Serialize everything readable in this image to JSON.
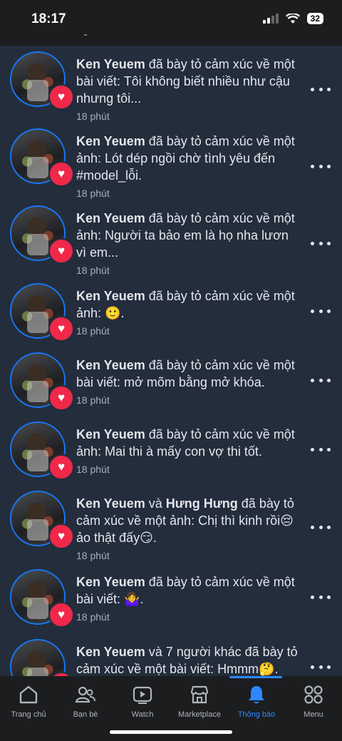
{
  "status": {
    "time": "18:17",
    "battery": "32"
  },
  "notifications": [
    {
      "actor": "Ken Yeuem",
      "actor2": "",
      "pre": "",
      "mid": "",
      "action": " đã bày tỏ cảm xúc về một bài viết: Tôi không biết nhiều như cậu nhưng tôi...",
      "time": "18 phút"
    },
    {
      "actor": "Ken Yeuem",
      "actor2": "",
      "pre": "",
      "mid": "",
      "action": " đã bày tỏ cảm xúc về một ảnh: Lót dép ngồi chờ tình yêu đến #model_lỗi.",
      "time": "18 phút"
    },
    {
      "actor": "Ken Yeuem",
      "actor2": "",
      "pre": "",
      "mid": "",
      "action": " đã bày tỏ cảm xúc về một ảnh: Người ta bảo em là họ nha lươn vì em...",
      "time": "18 phút"
    },
    {
      "actor": "Ken Yeuem",
      "actor2": "",
      "pre": "",
      "mid": "",
      "action": " đã bày tỏ cảm xúc về một ảnh: 🙂.",
      "time": "18 phút"
    },
    {
      "actor": "Ken Yeuem",
      "actor2": "",
      "pre": "",
      "mid": "",
      "action": " đã bày tỏ cảm xúc về một bài viết: mở mõm bằng mở khóa.",
      "time": "18 phút"
    },
    {
      "actor": "Ken Yeuem",
      "actor2": "",
      "pre": "",
      "mid": "",
      "action": " đã bày tỏ cảm xúc về một ảnh: Mai thi à mấy con vợ thi tốt.",
      "time": "18 phút"
    },
    {
      "actor": "Ken Yeuem",
      "actor2": "Hưng Hưng",
      "pre": "",
      "mid": " và ",
      "action": " đã bày tỏ cảm xúc về một ảnh: Chị thì kinh rồi😔 ảo thật đấy😏.",
      "time": "18 phút"
    },
    {
      "actor": "Ken Yeuem",
      "actor2": "",
      "pre": "",
      "mid": "",
      "action": " đã bày tỏ cảm xúc về một bài viết: 🤷‍♀️.",
      "time": "18 phút"
    },
    {
      "actor": "Ken Yeuem",
      "actor2": "",
      "pre": "",
      "mid": "",
      "action": " và 7 người khác đã bày tỏ cảm xúc về một bài viết: Hmmm🤔.",
      "time": ""
    }
  ],
  "tabs": [
    {
      "label": "Trang chủ",
      "icon": "home-icon"
    },
    {
      "label": "Bạn bè",
      "icon": "friends-icon"
    },
    {
      "label": "Watch",
      "icon": "watch-icon"
    },
    {
      "label": "Marketplace",
      "icon": "marketplace-icon"
    },
    {
      "label": "Thông báo",
      "icon": "bell-icon"
    },
    {
      "label": "Menu",
      "icon": "menu-icon"
    }
  ],
  "colors": {
    "accent": "#2d88ff",
    "reaction": "#f0284a",
    "background": "#232d3c"
  }
}
